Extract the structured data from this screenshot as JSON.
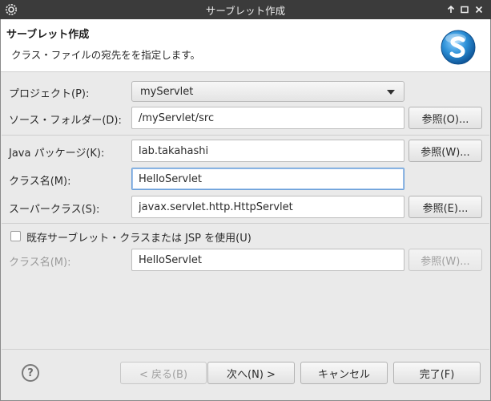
{
  "window": {
    "title": "サーブレット作成"
  },
  "banner": {
    "title": "サーブレット作成",
    "description": "クラス・ファイルの宛先をを指定します。"
  },
  "form": {
    "project": {
      "label": "プロジェクト(P):",
      "value": "myServlet"
    },
    "source_folder": {
      "label": "ソース・フォルダー(D):",
      "value": "/myServlet/src",
      "browse": "参照(O)..."
    },
    "java_package": {
      "label": "Java パッケージ(K):",
      "value": "lab.takahashi",
      "browse": "参照(W)..."
    },
    "class_name": {
      "label": "クラス名(M):",
      "value": "HelloServlet"
    },
    "superclass": {
      "label": "スーパークラス(S):",
      "value": "javax.servlet.http.HttpServlet",
      "browse": "参照(E)..."
    },
    "existing": {
      "label": "既存サーブレット・クラスまたは JSP を使用(U)",
      "checked": false
    },
    "existing_class": {
      "label": "クラス名(M):",
      "value": "HelloServlet",
      "browse": "参照(W)..."
    }
  },
  "footer": {
    "back": "< 戻る(B)",
    "next": "次へ(N) >",
    "cancel": "キャンセル",
    "finish": "完了(F)"
  },
  "icons": {
    "app": "gear-icon",
    "help": "help-icon",
    "logo": "servlet-wizard-logo",
    "maximize_title": "arrow-up-icon",
    "restore": "restore-icon",
    "close": "close-icon"
  },
  "colors": {
    "titlebar": "#3b3b3b",
    "dialog_bg": "#eaeaea",
    "logo_blue": "#2b8fd6",
    "focus_border": "#6a9fd8"
  }
}
